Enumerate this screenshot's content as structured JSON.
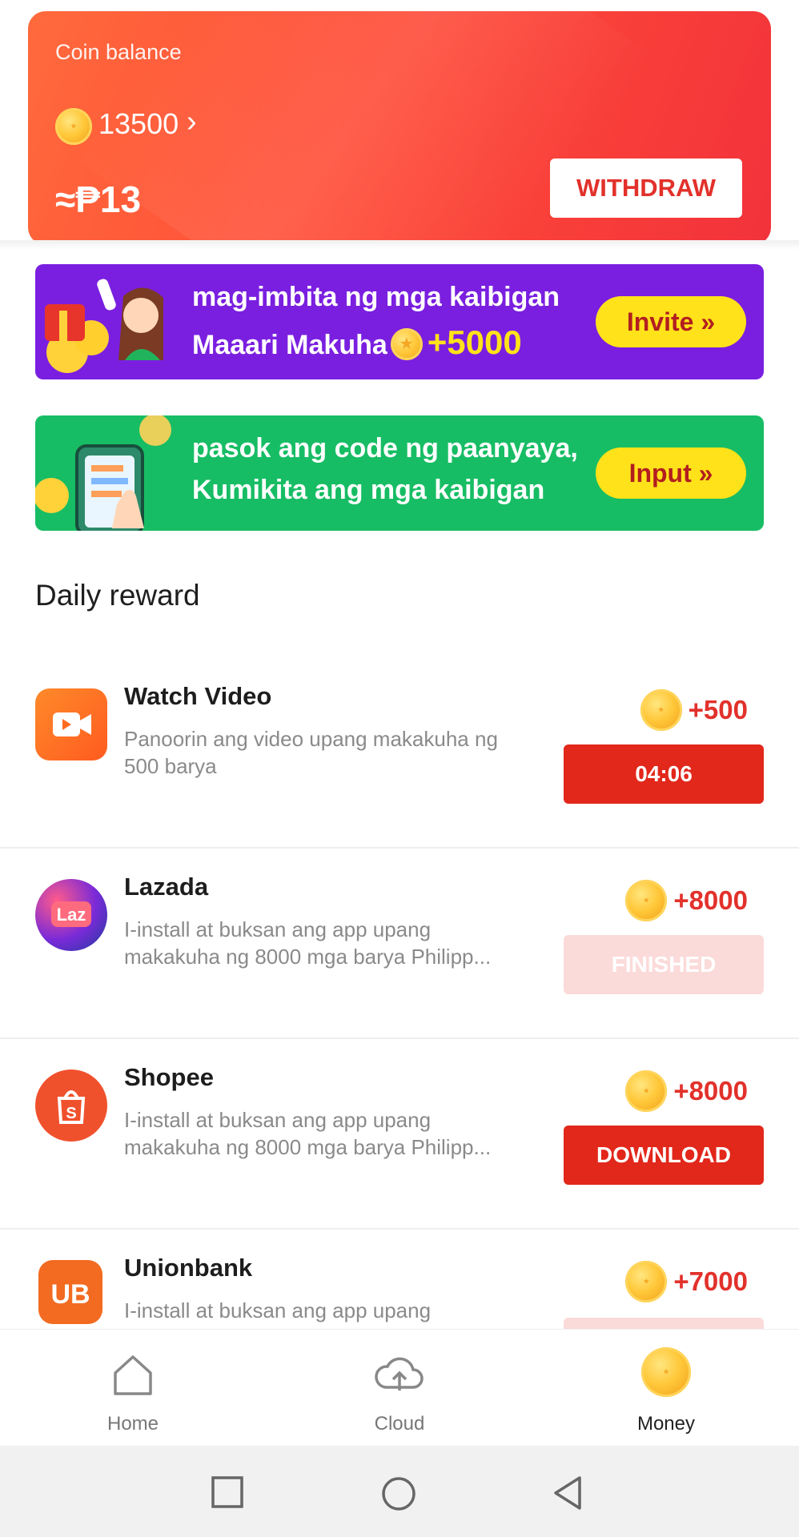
{
  "balance": {
    "label": "Coin balance",
    "coins": "13500",
    "approx_value": "≈₱13",
    "withdraw_label": "WITHDRAW"
  },
  "invite_banner": {
    "line1": "mag-imbita ng mga kaibigan",
    "line2": "Maaari Makuha",
    "bonus": "+5000",
    "button_label": "Invite »"
  },
  "code_banner": {
    "line1": "pasok ang code ng paanyaya,",
    "line2": "Kumikita ang mga kaibigan",
    "button_label": "Input »"
  },
  "daily_reward": {
    "title": "Daily reward",
    "tasks": [
      {
        "name": "Watch Video",
        "desc": "Panoorin ang video upang makakuha ng 500 barya",
        "reward": "+500",
        "button": "04:06"
      },
      {
        "name": "Lazada",
        "desc": "I-install at buksan ang app upang makakuha ng 8000 mga barya Philipp...",
        "reward": "+8000",
        "button": "FINISHED"
      },
      {
        "name": "Shopee",
        "desc": "I-install at buksan ang app upang makakuha ng 8000 mga barya Philipp...",
        "reward": "+8000",
        "button": "DOWNLOAD"
      },
      {
        "name": "Unionbank",
        "desc": "I-install at buksan ang app upang",
        "reward": "+7000"
      }
    ]
  },
  "nav": {
    "home": "Home",
    "cloud": "Cloud",
    "money": "Money"
  },
  "colors": {
    "accent_red": "#e2271b",
    "invite_purple": "#7a1fe0",
    "code_green": "#17bd64",
    "pill_yellow": "#ffe21a"
  }
}
